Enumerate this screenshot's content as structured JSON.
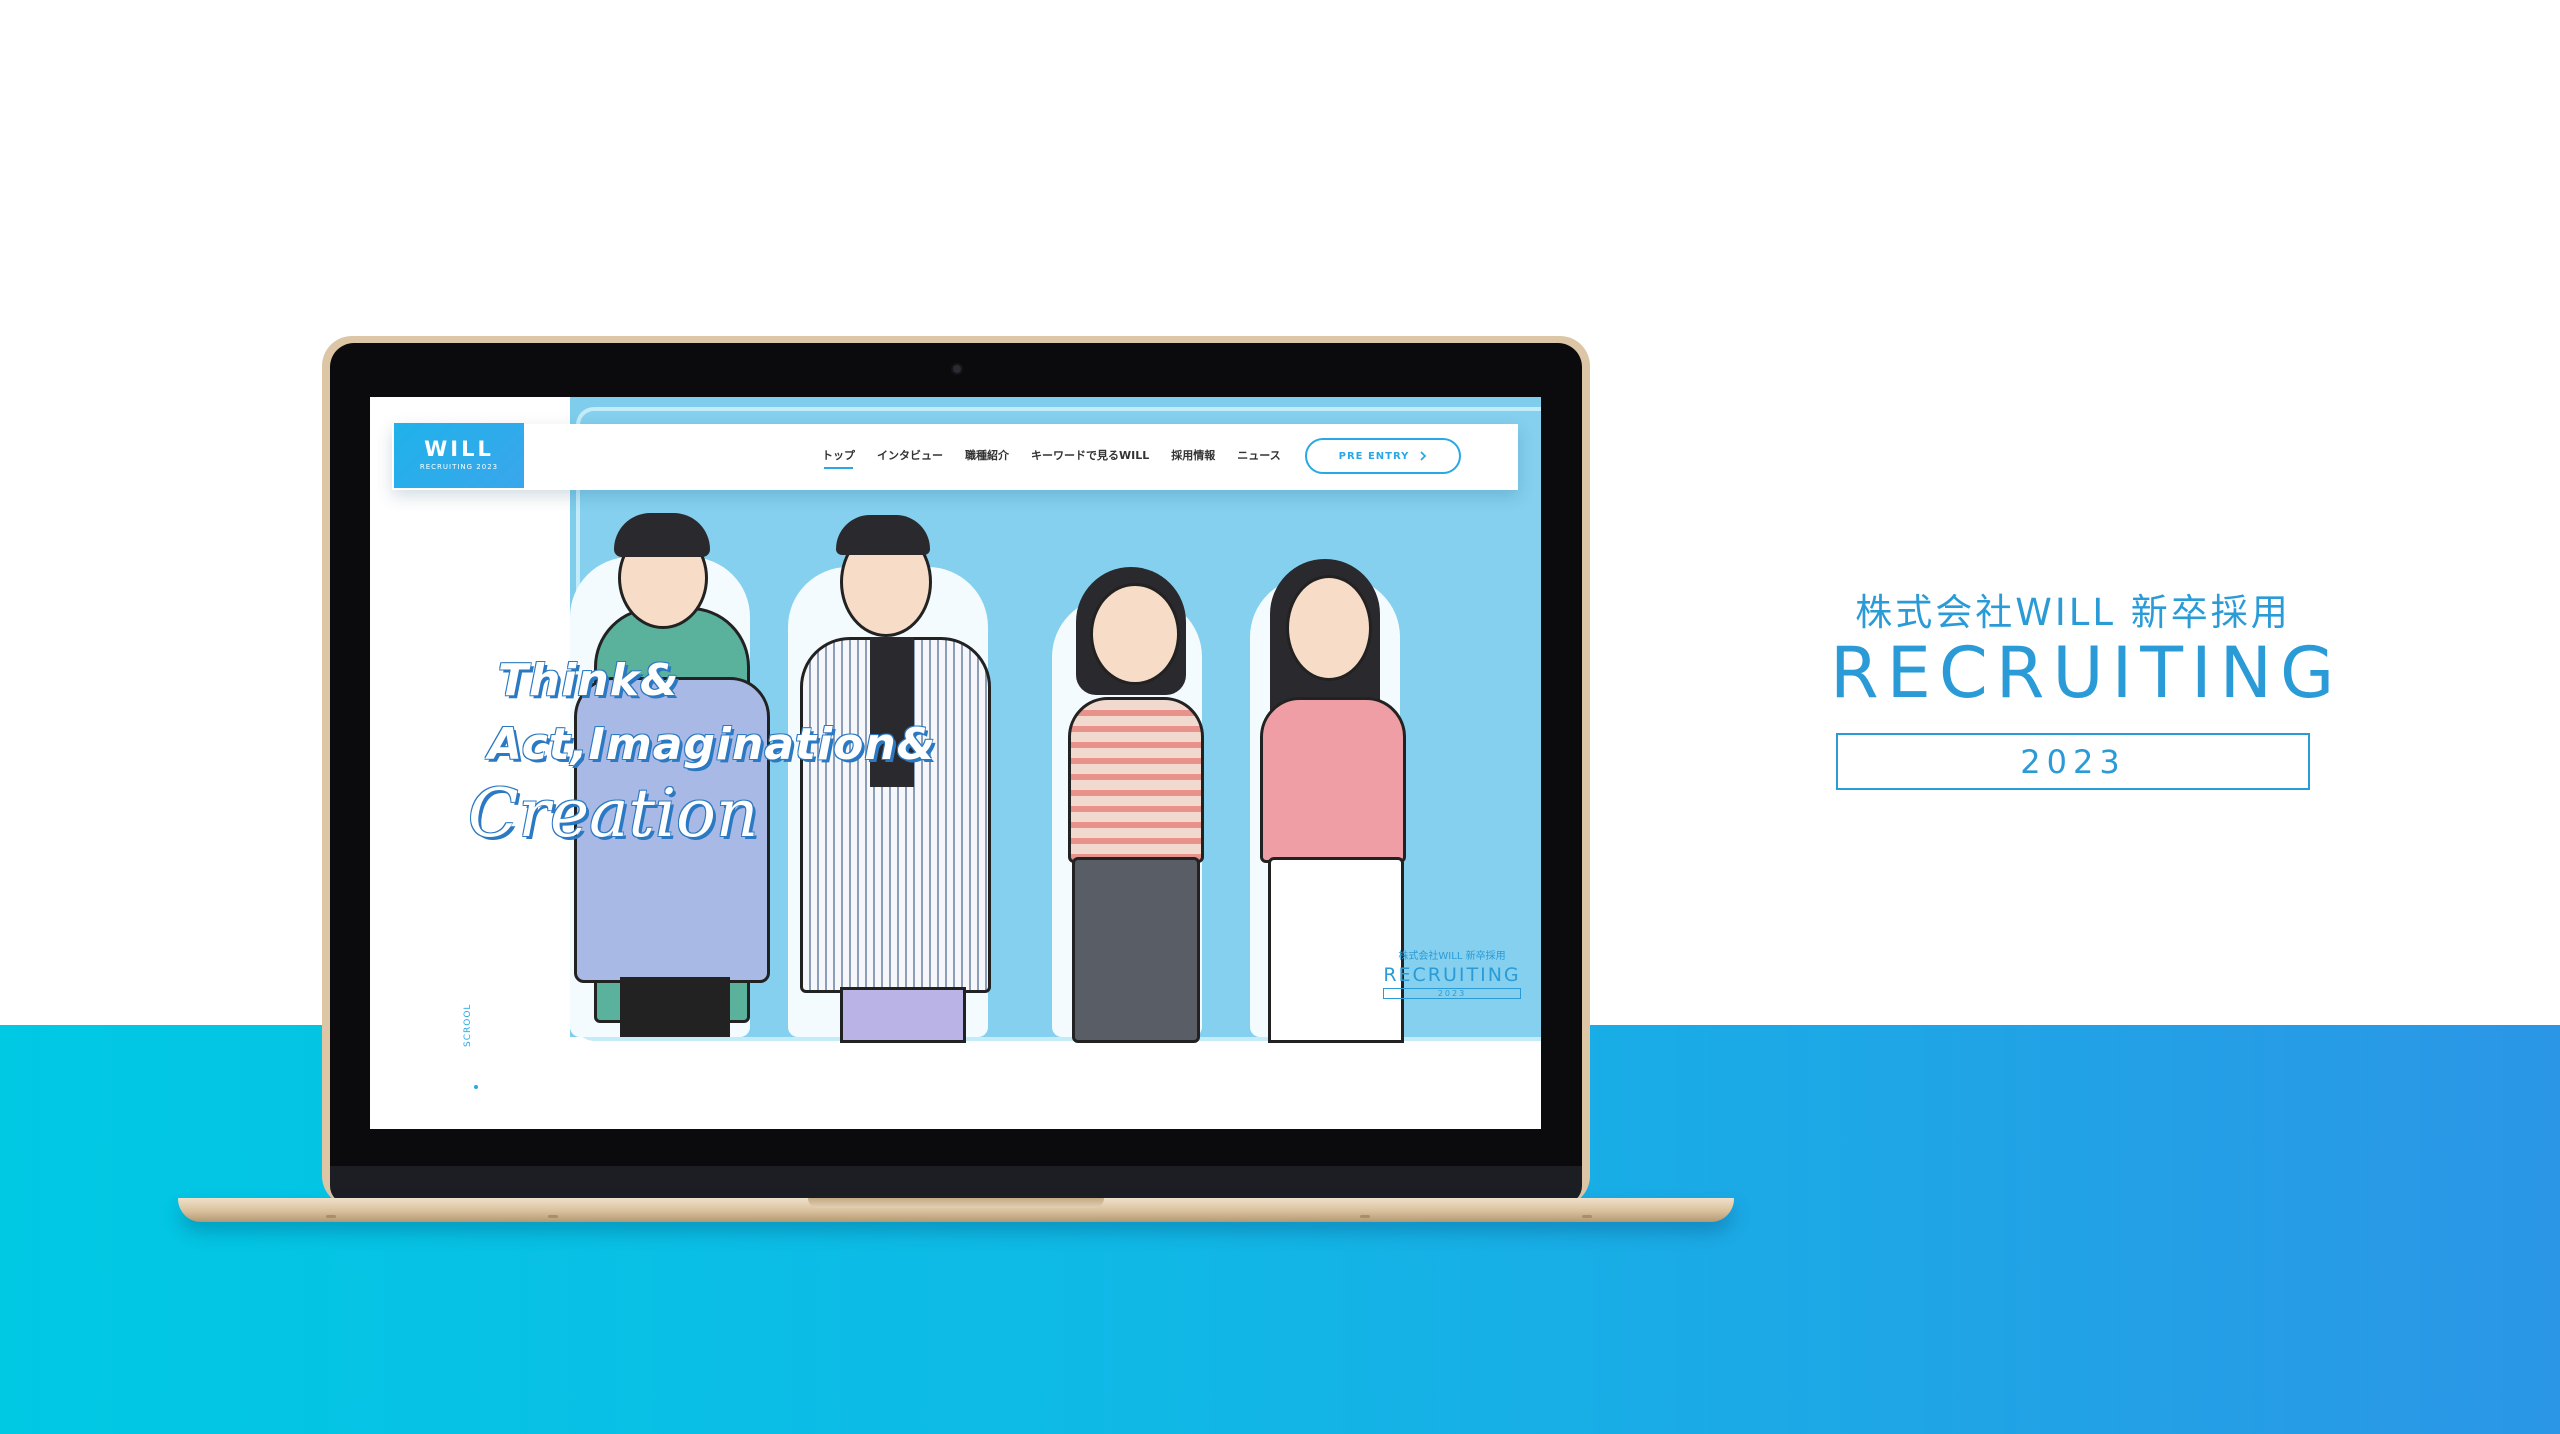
{
  "site": {
    "logo_word": "WILL",
    "logo_sub": "RECRUITING 2023",
    "nav": [
      "トップ",
      "インタビュー",
      "職種紹介",
      "キーワードで見るWILL",
      "採用情報",
      "ニュース"
    ],
    "entry_label": "PRE ENTRY",
    "entry_icon": "chevron-right-icon",
    "scroll_label": "SCROOL",
    "slogan": {
      "line1": "Think&",
      "line2": "Act,Imagination&",
      "line3": "Creation"
    },
    "hero_badge": {
      "company": "株式会社WILL 新卒採用",
      "title": "RECRUITING",
      "year": "2023"
    }
  },
  "promo": {
    "company": "株式会社WILL 新卒採用",
    "title": "RECRUITING",
    "year": "2023"
  },
  "colors": {
    "accent": "#2a9bd7",
    "hero_bg": "#7ecdec",
    "floor_start": "#00c9e4",
    "floor_end": "#2b96e6"
  }
}
